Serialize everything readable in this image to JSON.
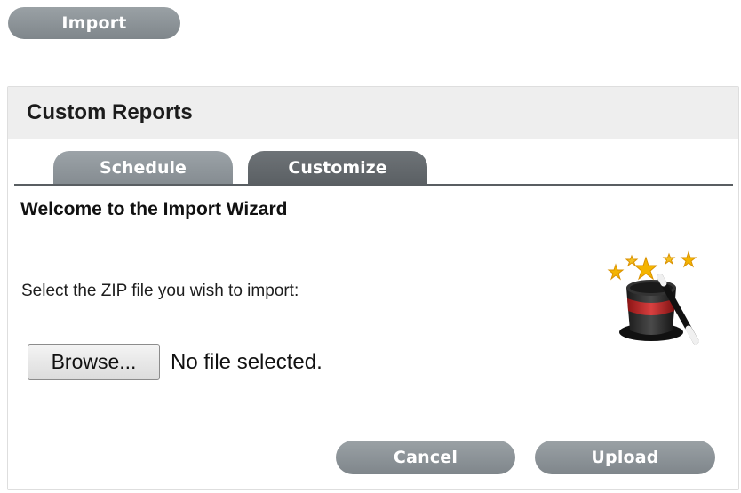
{
  "toolbar": {
    "import_label": "Import"
  },
  "panel": {
    "title": "Custom Reports",
    "tabs": [
      {
        "label": "Schedule",
        "active": false
      },
      {
        "label": "Customize",
        "active": true
      }
    ]
  },
  "wizard": {
    "title": "Welcome to the Import Wizard",
    "prompt": "Select the ZIP file you wish to import:",
    "browse_label": "Browse...",
    "file_status": "No file selected.",
    "icon": "magic-hat-icon",
    "cancel_label": "Cancel",
    "upload_label": "Upload"
  }
}
